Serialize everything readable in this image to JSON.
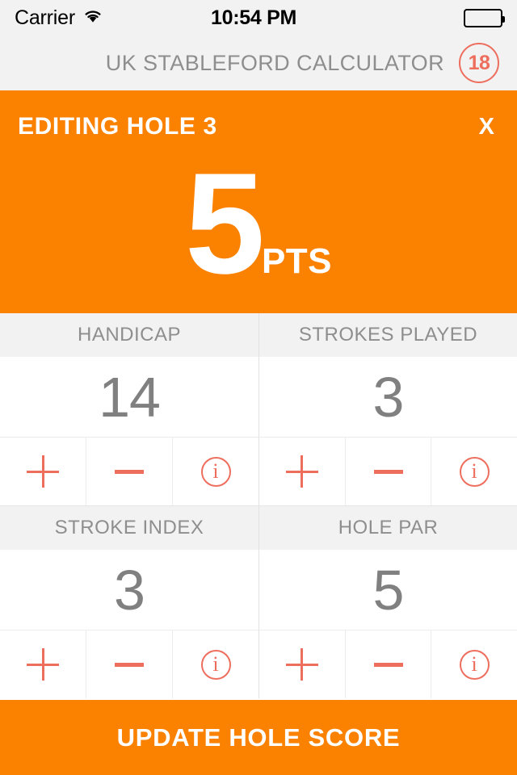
{
  "status_bar": {
    "carrier": "Carrier",
    "wifi_icon": "wifi-icon",
    "time": "10:54 PM",
    "battery_icon": "battery-full-icon"
  },
  "nav": {
    "app_title": "UK STABLEFORD CALCULATOR",
    "hole_badge": "18"
  },
  "banner": {
    "title": "EDITING HOLE 3",
    "close_label": "X",
    "score_value": "5",
    "score_unit": "PTS",
    "background_color": "#FA8200"
  },
  "stats": [
    {
      "label": "HANDICAP",
      "value": "14",
      "buttons": [
        {
          "name": "increment",
          "glyph": "plus-icon"
        },
        {
          "name": "decrement",
          "glyph": "minus-icon"
        },
        {
          "name": "info",
          "glyph": "info-icon",
          "letter": "i"
        }
      ]
    },
    {
      "label": "STROKES PLAYED",
      "value": "3",
      "buttons": [
        {
          "name": "increment",
          "glyph": "plus-icon"
        },
        {
          "name": "decrement",
          "glyph": "minus-icon"
        },
        {
          "name": "info",
          "glyph": "info-icon",
          "letter": "i"
        }
      ]
    },
    {
      "label": "STROKE INDEX",
      "value": "3",
      "buttons": [
        {
          "name": "increment",
          "glyph": "plus-icon"
        },
        {
          "name": "decrement",
          "glyph": "minus-icon"
        },
        {
          "name": "info",
          "glyph": "info-icon",
          "letter": "i"
        }
      ]
    },
    {
      "label": "HOLE PAR",
      "value": "5",
      "buttons": [
        {
          "name": "increment",
          "glyph": "plus-icon"
        },
        {
          "name": "decrement",
          "glyph": "minus-icon"
        },
        {
          "name": "info",
          "glyph": "info-icon",
          "letter": "i"
        }
      ]
    }
  ],
  "cta": {
    "label": "UPDATE HOLE SCORE",
    "background_color": "#FA8200"
  },
  "colors": {
    "orange": "#FA8200",
    "coral": "#EE6E5E",
    "grey_text": "#8E8E8E",
    "value_grey": "#808080",
    "panel_grey": "#F2F2F2"
  }
}
